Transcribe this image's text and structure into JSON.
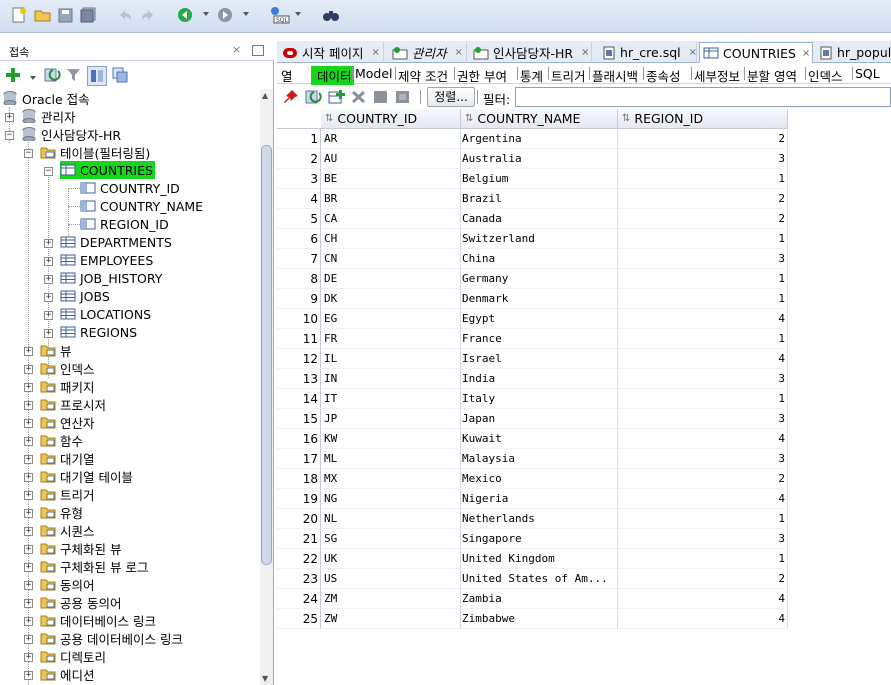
{
  "toolbar": {
    "icons": [
      "new-icon",
      "open-icon",
      "save-icon",
      "save-all-icon",
      "undo-icon",
      "redo-icon",
      "back-icon",
      "forward-icon",
      "sql-worksheet-icon",
      "binoculars-icon"
    ]
  },
  "left_panel": {
    "title": "접속",
    "close_glyph": "×",
    "tree": {
      "root": "Oracle 접속",
      "admin": "관리자",
      "hr": "인사담당자-HR",
      "tables_folder": "테이블(필터링됨)",
      "countries": "COUNTRIES",
      "columns": [
        "COUNTRY_ID",
        "COUNTRY_NAME",
        "REGION_ID"
      ],
      "tables": [
        "DEPARTMENTS",
        "EMPLOYEES",
        "JOB_HISTORY",
        "JOBS",
        "LOCATIONS",
        "REGIONS"
      ],
      "folders": [
        "뷰",
        "인덱스",
        "패키지",
        "프로시저",
        "연산자",
        "함수",
        "대기열",
        "대기열 테이블",
        "트리거",
        "유형",
        "시퀀스",
        "구체화된 뷰",
        "구체화된 뷰 로그",
        "동의어",
        "공용 동의어",
        "데이터베이스 링크",
        "공용 데이터베이스 링크",
        "디렉토리",
        "에디션"
      ]
    }
  },
  "tabs": [
    {
      "label": "시작 페이지",
      "close": "×"
    },
    {
      "label": "관리자",
      "close": "×"
    },
    {
      "label": "인사담당자-HR",
      "close": "×"
    },
    {
      "label": "hr_cre.sql",
      "close": "×"
    },
    {
      "label": "COUNTRIES",
      "close": "×"
    },
    {
      "label": "hr_popul.",
      "close": ""
    }
  ],
  "subtabs": [
    "열",
    "데이터",
    "Model",
    "제약 조건",
    "권한 부여",
    "통계",
    "트리거",
    "플래시백",
    "종속성",
    "세부정보",
    "분할 영역",
    "인덱스",
    "SQL"
  ],
  "grid_toolbar": {
    "sort_label": "정렬...",
    "filter_label": "필터:",
    "filter_value": ""
  },
  "grid": {
    "columns": [
      "COUNTRY_ID",
      "COUNTRY_NAME",
      "REGION_ID"
    ],
    "rows": [
      [
        "1",
        "AR",
        "Argentina",
        "2"
      ],
      [
        "2",
        "AU",
        "Australia",
        "3"
      ],
      [
        "3",
        "BE",
        "Belgium",
        "1"
      ],
      [
        "4",
        "BR",
        "Brazil",
        "2"
      ],
      [
        "5",
        "CA",
        "Canada",
        "2"
      ],
      [
        "6",
        "CH",
        "Switzerland",
        "1"
      ],
      [
        "7",
        "CN",
        "China",
        "3"
      ],
      [
        "8",
        "DE",
        "Germany",
        "1"
      ],
      [
        "9",
        "DK",
        "Denmark",
        "1"
      ],
      [
        "10",
        "EG",
        "Egypt",
        "4"
      ],
      [
        "11",
        "FR",
        "France",
        "1"
      ],
      [
        "12",
        "IL",
        "Israel",
        "4"
      ],
      [
        "13",
        "IN",
        "India",
        "3"
      ],
      [
        "14",
        "IT",
        "Italy",
        "1"
      ],
      [
        "15",
        "JP",
        "Japan",
        "3"
      ],
      [
        "16",
        "KW",
        "Kuwait",
        "4"
      ],
      [
        "17",
        "ML",
        "Malaysia",
        "3"
      ],
      [
        "18",
        "MX",
        "Mexico",
        "2"
      ],
      [
        "19",
        "NG",
        "Nigeria",
        "4"
      ],
      [
        "20",
        "NL",
        "Netherlands",
        "1"
      ],
      [
        "21",
        "SG",
        "Singapore",
        "3"
      ],
      [
        "22",
        "UK",
        "United Kingdom",
        "1"
      ],
      [
        "23",
        "US",
        "United States of Am...",
        "2"
      ],
      [
        "24",
        "ZM",
        "Zambia",
        "4"
      ],
      [
        "25",
        "ZW",
        "Zimbabwe",
        "4"
      ]
    ]
  },
  "colors": {
    "highlight": "#16d71b",
    "toolbar_bg": "#dbe5f3",
    "tab_red": "#d10000"
  }
}
